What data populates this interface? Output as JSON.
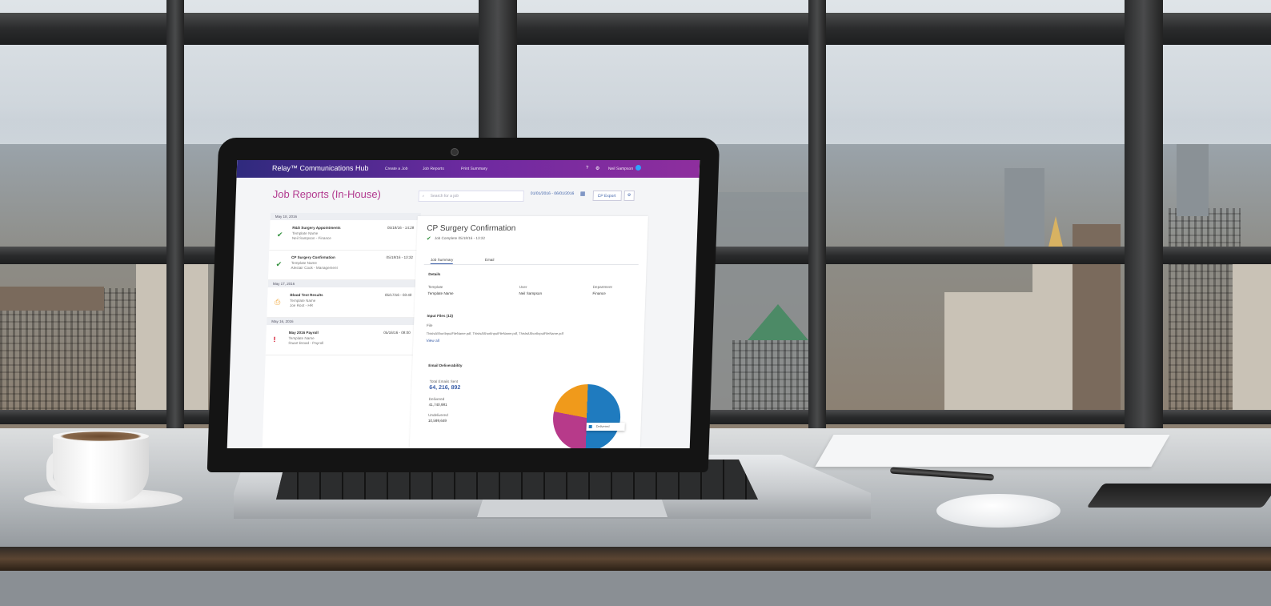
{
  "app": {
    "brand": "Relay™ Communications Hub",
    "nav": [
      "Create a Job",
      "Job Reports",
      "Print Summary"
    ],
    "user": "Neil Sampson",
    "help_icon": "question-icon",
    "settings_icon": "gear-icon"
  },
  "page": {
    "title": "Job Reports (In-House)",
    "search_placeholder": "Search for a job",
    "date_range": "01/01/2016 - 06/01/2016",
    "export_label": "CP Export"
  },
  "jobs": {
    "groups": [
      {
        "date": "May 18, 2016",
        "items": [
          {
            "title": "R&S Surgery Appointments",
            "sub1": "Template Name",
            "sub2": "Neil Sampson - Finance",
            "date": "05/18/16 - 14:28",
            "status": "complete"
          },
          {
            "title": "CP Surgery Confirmation",
            "sub1": "Template Name",
            "sub2": "Alestair Cook - Management",
            "date": "05/18/16 - 13:32",
            "status": "complete"
          }
        ]
      },
      {
        "date": "May 17, 2016",
        "items": [
          {
            "title": "Blood Test Results",
            "sub1": "Template Name",
            "sub2": "Joe Root - HR",
            "date": "05/17/16 - 03:40",
            "status": "printing"
          }
        ]
      },
      {
        "date": "May 16, 2016",
        "items": [
          {
            "title": "May 2016 Payroll",
            "sub1": "Template Name",
            "sub2": "Stuart Broad - Payroll",
            "date": "05/16/16 - 08:00",
            "status": "error"
          }
        ]
      }
    ]
  },
  "detail": {
    "title": "CP Surgery Confirmation",
    "status_line": "Job Complete 05/18/16 - 13:32",
    "tabs": [
      "Job Summary",
      "Email"
    ],
    "details_heading": "Details",
    "details": [
      {
        "label": "Template",
        "value": "Template Name"
      },
      {
        "label": "User",
        "value": "Neil Sampson"
      },
      {
        "label": "Department",
        "value": "Finance"
      }
    ],
    "input_files_heading": "Input Files (13)",
    "file_label": "File",
    "files_text": "ThisIsAShortInputFileName.pdf, ThisIsAShortInputFileName.pdf, ThisIsAShortInputFileName.pdf",
    "view_all": "View all",
    "deliverability_heading": "Email Deliverability",
    "total_label": "Total Emails Sent",
    "total_value": "64, 216, 892",
    "delivered_label": "Delivered",
    "delivered_value": "41,740,981",
    "undelivered_label": "Undelivered",
    "undelivered_value": "10,599,649",
    "legend_delivered": "Delivered"
  },
  "colors": {
    "appbar_start": "#2f2a7d",
    "appbar_end": "#8e2e9e",
    "title": "#b23a8f",
    "link": "#3b5fa8",
    "success": "#2f8f3a",
    "warning": "#f09a1b",
    "error": "#d0021b"
  }
}
